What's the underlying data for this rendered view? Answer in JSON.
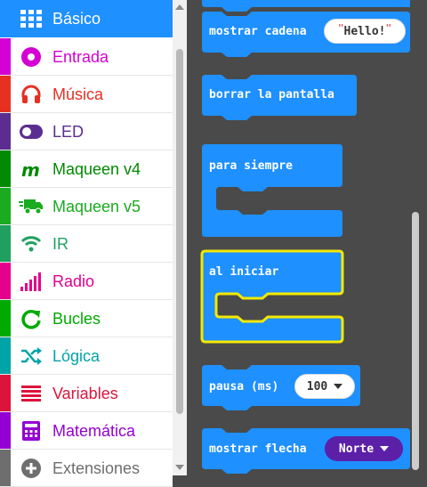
{
  "toolbox": {
    "categories": [
      {
        "label": "Básico",
        "color": "#1e90ff",
        "icon": "grid-icon",
        "selected": true
      },
      {
        "label": "Entrada",
        "color": "#d400d4",
        "icon": "target-icon"
      },
      {
        "label": "Música",
        "color": "#e63022",
        "icon": "headphones-icon"
      },
      {
        "label": "LED",
        "color": "#5c2d91",
        "icon": "toggle-icon"
      },
      {
        "label": "Maqueen v4",
        "color": "#008a00",
        "icon": "m-logo-icon"
      },
      {
        "label": "Maqueen v5",
        "color": "#1aab20",
        "icon": "truck-icon"
      },
      {
        "label": "IR",
        "color": "#20a060",
        "icon": "wifi-icon"
      },
      {
        "label": "Radio",
        "color": "#e3008c",
        "icon": "signal-bars-icon"
      },
      {
        "label": "Bucles",
        "color": "#00aa00",
        "icon": "loop-arrow-icon"
      },
      {
        "label": "Lógica",
        "color": "#00a4a6",
        "icon": "shuffle-icon"
      },
      {
        "label": "Variables",
        "color": "#dc143c",
        "icon": "list-lines-icon"
      },
      {
        "label": "Matemática",
        "color": "#9400d3",
        "icon": "calculator-icon"
      },
      {
        "label": "Extensiones",
        "color": "#6e6e6e",
        "icon": "plus-circle-icon"
      }
    ]
  },
  "blocks": {
    "show_string": {
      "label": "mostrar cadena",
      "value": "Hello!",
      "color": "#1e90ff"
    },
    "clear_screen": {
      "label": "borrar la pantalla",
      "color": "#1e90ff"
    },
    "forever": {
      "label": "para siempre",
      "color": "#1e90ff"
    },
    "on_start": {
      "label": "al iniciar",
      "color": "#1e90ff",
      "highlight": "#f3e800"
    },
    "pause": {
      "label": "pausa (ms)",
      "value": "100",
      "color": "#1e90ff"
    },
    "show_arrow": {
      "label": "mostrar flecha",
      "value": "Norte",
      "color": "#1e90ff",
      "dropdown_color": "#5c1fa8"
    }
  }
}
